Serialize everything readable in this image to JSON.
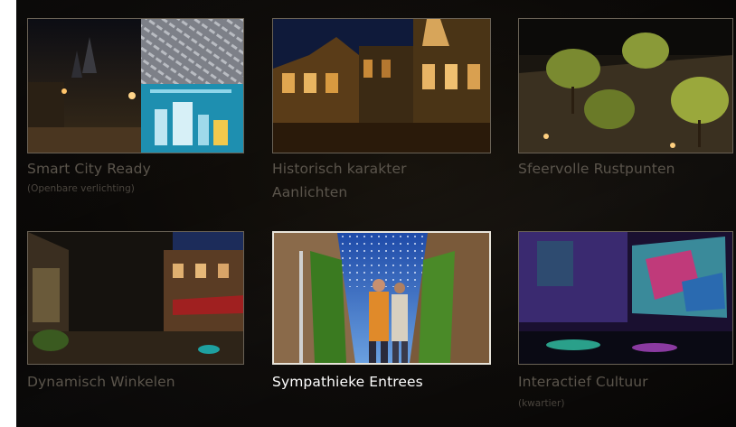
{
  "grid": {
    "tiles": [
      {
        "id": "smart-city",
        "title": "Smart City Ready",
        "title2": "",
        "subtitle": "(Openbare verlichting)",
        "active": false,
        "image": "collage of night street and smart city infographic"
      },
      {
        "id": "historisch",
        "title": "Historisch karakter",
        "title2": "Aanlichten",
        "subtitle": "",
        "active": false,
        "image": "illuminated historic facades at night"
      },
      {
        "id": "sfeervolle",
        "title": "Sfeervolle Rustpunten",
        "title2": "",
        "subtitle": "",
        "active": false,
        "image": "lit trees on a square at night"
      },
      {
        "id": "dynamisch",
        "title": "Dynamisch Winkelen",
        "title2": "",
        "subtitle": "",
        "active": false,
        "image": "shopping street at night"
      },
      {
        "id": "sympathieke",
        "title": "Sympathieke Entrees",
        "title2": "",
        "subtitle": "",
        "active": true,
        "image": "alley with overhead string lights and couple walking"
      },
      {
        "id": "interactief",
        "title": "Interactief Cultuur",
        "title2": "",
        "subtitle": "(kwartier)",
        "active": false,
        "image": "colorful projection on building wall"
      }
    ]
  }
}
